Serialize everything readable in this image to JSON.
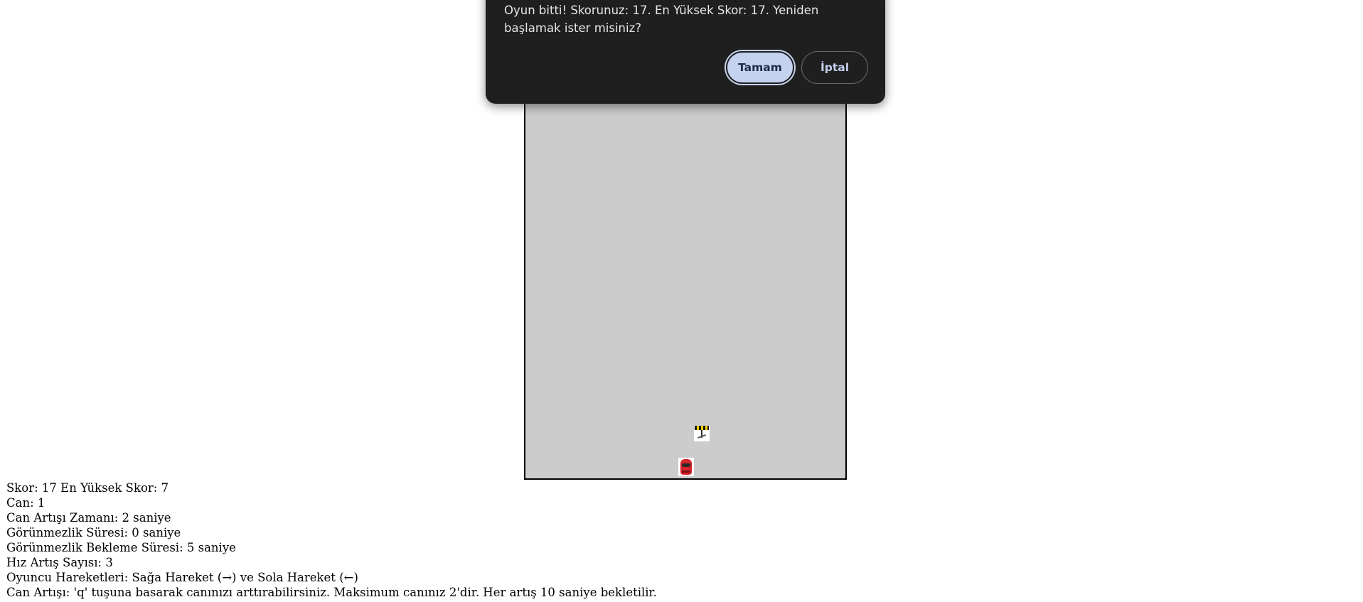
{
  "dialog": {
    "message": "Oyun bitti! Skorunuz: 17. En Yüksek Skor: 17. Yeniden başlamak ister misiniz?",
    "ok_label": "Tamam",
    "cancel_label": "İptal"
  },
  "game": {
    "canvas_color": "#cccccc",
    "obstacle_icon": "barrier-icon",
    "player_icon": "red-car-icon"
  },
  "info": {
    "score_line": "Skor: 17 En Yüksek Skor: 7",
    "lives_line": "Can: 1",
    "life_gain_time_line": "Can Artışı Zamanı: 2 saniye",
    "invisibility_duration_line": "Görünmezlik Süresi: 0 saniye",
    "invisibility_cooldown_line": "Görünmezlik Bekleme Süresi: 5 saniye",
    "speed_increase_line": "Hız Artış Sayısı: 3",
    "controls_line": "Oyuncu Hareketleri: Sağa Hareket (→) ve Sola Hareket (←)",
    "life_gain_help_line": "Can Artışı: 'q' tuşuna basarak canınızı arttırabilirsiniz. Maksimum canınız 2'dir. Her artış 10 saniye bekletilir."
  }
}
